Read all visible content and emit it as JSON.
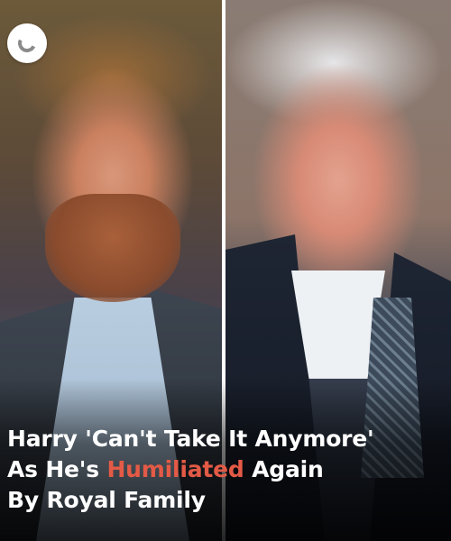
{
  "headline": {
    "line1": "Harry 'Can't Take It Anymore'",
    "line2_pre": "As He's ",
    "line2_highlight": "Humiliated",
    "line2_post": " Again",
    "line3": "By Royal Family"
  },
  "logo": {
    "icon": "brand-logo-icon"
  },
  "colors": {
    "highlight": "#e35a46",
    "headline_text": "#ffffff",
    "divider": "#ffffff"
  }
}
